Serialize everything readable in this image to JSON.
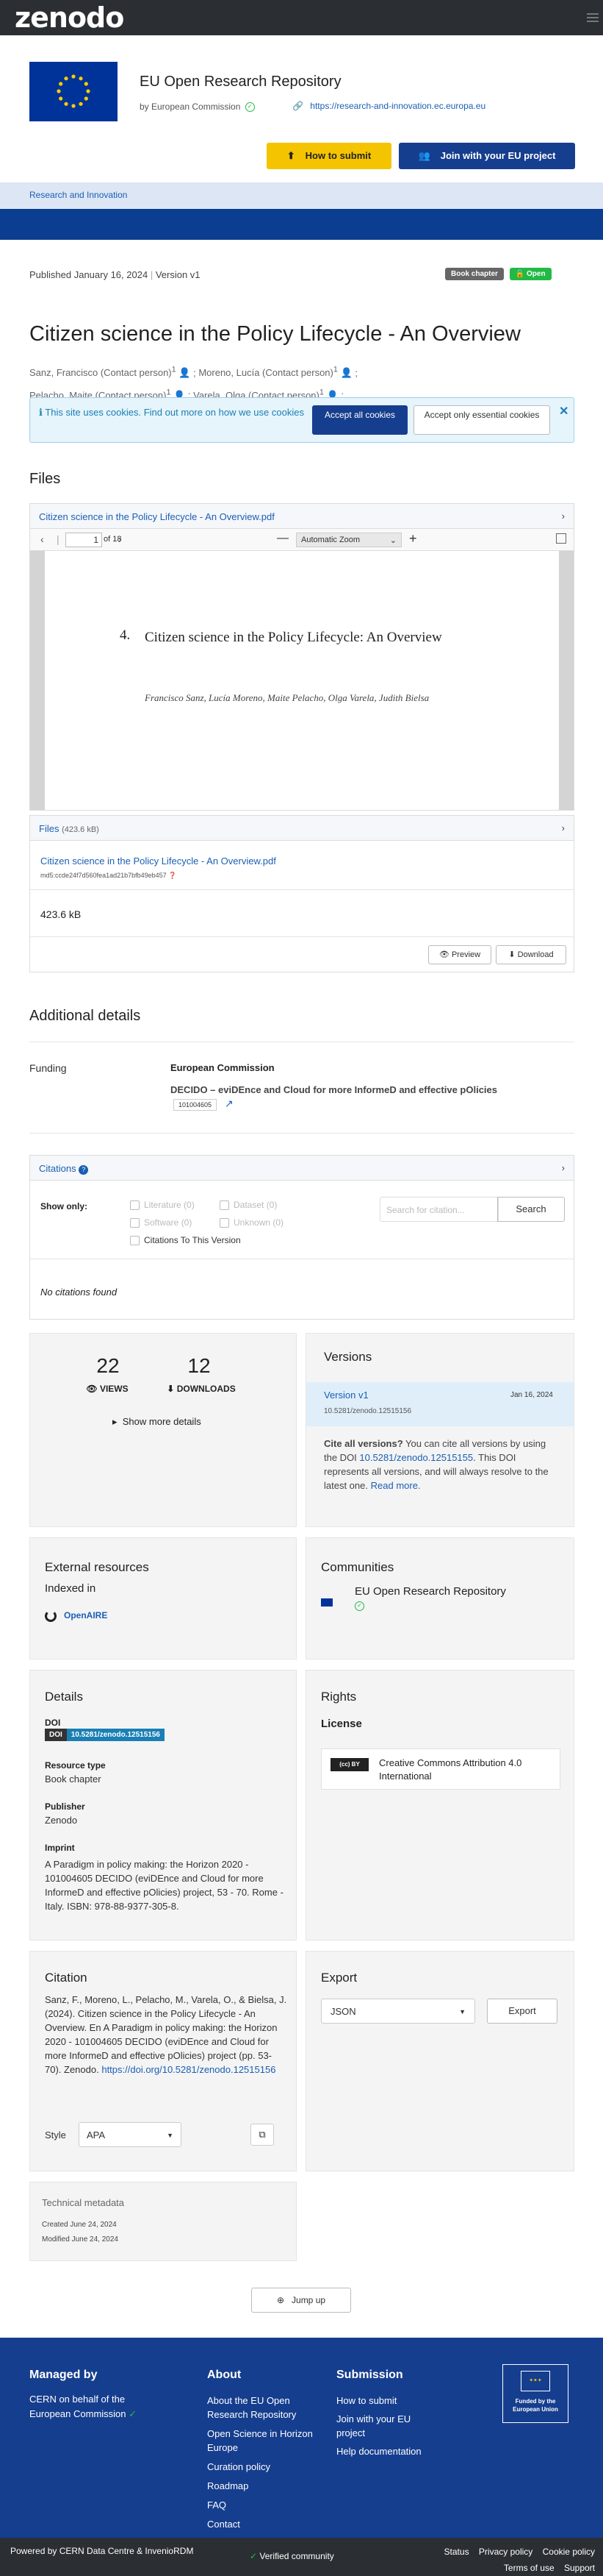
{
  "brand": {
    "logo_text": "zenodo"
  },
  "community": {
    "name": "EU Open Research Repository",
    "by": "by European Commission",
    "url": "https://research-and-innovation.ec.europa.eu",
    "how_to_submit": "How to submit",
    "join": "Join with your EU project",
    "band_label": "Research and Innovation"
  },
  "record": {
    "published": "Published January 16, 2024",
    "version": "Version v1",
    "badge_type": "Book chapter",
    "badge_open": "Open",
    "title": "Citizen science in the Policy Lifecycle - An Overview",
    "creators": [
      "Sanz, Francisco (Contact person)",
      "Moreno, Lucía (Contact person)",
      "Pelacho, Maite (Contact person)",
      "Varela, Olga (Contact person)"
    ],
    "creator_sup": "1"
  },
  "cookies": {
    "text": "This site uses cookies. Find out more on how we use cookies",
    "accept_all": "Accept all cookies",
    "accept_essential": "Accept only essential cookies"
  },
  "files": {
    "heading": "Files",
    "preview_file": "Citizen science in the Policy Lifecycle - An Overview.pdf",
    "page_current": "1",
    "page_total": "of 18",
    "zoom": "Automatic Zoom",
    "pdf_chapter_num": "4.",
    "pdf_title": "Citizen science in the Policy Lifecycle: An Overview",
    "pdf_authors": "Francisco Sanz, Lucía Moreno, Maite Pelacho, Olga Varela, Judith Bielsa",
    "list_label": "Files",
    "list_size": "(423.6 kB)",
    "file_name": "Citizen science in the Policy Lifecycle - An Overview.pdf",
    "md5": "md5:ccde24f7d560fea1ad21b7bfb49eb457",
    "file_size": "423.6 kB",
    "preview_btn": "Preview",
    "download_btn": "Download"
  },
  "additional": {
    "heading": "Additional details",
    "funding_label": "Funding",
    "funder": "European Commission",
    "project": "DECIDO – eviDEnce and Cloud for more InformeD and effective pOlicies",
    "project_id": "101004605"
  },
  "citations": {
    "heading": "Citations",
    "show_only": "Show only:",
    "filters": [
      "Literature (0)",
      "Dataset (0)",
      "Software (0)",
      "Unknown (0)"
    ],
    "to_this_version": "Citations To This Version",
    "search_placeholder": "Search for citation...",
    "search_btn": "Search",
    "none": "No citations found"
  },
  "stats": {
    "views": "22",
    "views_label": "VIEWS",
    "downloads": "12",
    "downloads_label": "DOWNLOADS",
    "more": "Show more details"
  },
  "versions": {
    "heading": "Versions",
    "version": "Version v1",
    "date": "Jan 16, 2024",
    "doi": "10.5281/zenodo.12515156",
    "cite_all_bold": "Cite all versions?",
    "cite_all_text1": "You can cite all versions by using the DOI",
    "cite_all_doi": "10.5281/zenodo.12515155",
    "cite_all_text2": ". This DOI represents all versions, and will always resolve to the latest one.",
    "read_more": "Read more."
  },
  "external": {
    "heading": "External resources",
    "indexed": "Indexed in",
    "openaire": "OpenAIRE"
  },
  "communities": {
    "heading": "Communities",
    "name": "EU Open Research Repository"
  },
  "details": {
    "heading": "Details",
    "doi_label": "DOI",
    "doi_tag": "DOI",
    "doi_value": "10.5281/zenodo.12515156",
    "resource_label": "Resource type",
    "resource_value": "Book chapter",
    "publisher_label": "Publisher",
    "publisher_value": "Zenodo",
    "imprint_label": "Imprint",
    "imprint_value": "A Paradigm in policy making: the Horizon 2020 - 101004605 DECIDO (eviDEnce and Cloud for more InformeD and effective pOlicies) project, 53 - 70. Rome - Italy. ISBN: 978-88-9377-305-8."
  },
  "rights": {
    "heading": "Rights",
    "license_heading": "License",
    "license": "Creative Commons Attribution 4.0 International"
  },
  "citation": {
    "heading": "Citation",
    "text": "Sanz, F., Moreno, L., Pelacho, M., Varela, O., & Bielsa, J. (2024). Citizen science in the Policy Lifecycle - An Overview. En A Paradigm in policy making: the Horizon 2020 - 101004605 DECIDO (eviDEnce and Cloud for more InformeD and effective pOlicies) project (pp. 53-70). Zenodo.",
    "link": "https://doi.org/10.5281/zenodo.12515156",
    "style_label": "Style",
    "style_value": "APA"
  },
  "export": {
    "heading": "Export",
    "format": "JSON",
    "btn": "Export"
  },
  "technical": {
    "heading": "Technical metadata",
    "created": "Created June 24, 2024",
    "modified": "Modified June 24, 2024"
  },
  "jump_up": "Jump up",
  "footer": {
    "managed_heading": "Managed by",
    "managed_text": "CERN on behalf of the European Commission",
    "about_heading": "About",
    "about_links": [
      "About the EU Open Research Repository",
      "Open Science in Horizon Europe",
      "Curation policy",
      "Roadmap",
      "FAQ",
      "Contact"
    ],
    "submission_heading": "Submission",
    "submission_links": [
      "How to submit",
      "Join with your EU project",
      "Help documentation"
    ],
    "funded_by": "Funded by the European Union",
    "powered": "Powered by CERN Data Centre & InvenioRDM",
    "verified": "Verified community",
    "bottom_links": [
      "Status",
      "Privacy policy",
      "Cookie policy",
      "Terms of use",
      "Support"
    ]
  },
  "colors": {
    "accent": "#1a5fb4",
    "eu_blue": "#163e8e",
    "yellow": "#f5c400",
    "open_green": "#21ba45"
  }
}
